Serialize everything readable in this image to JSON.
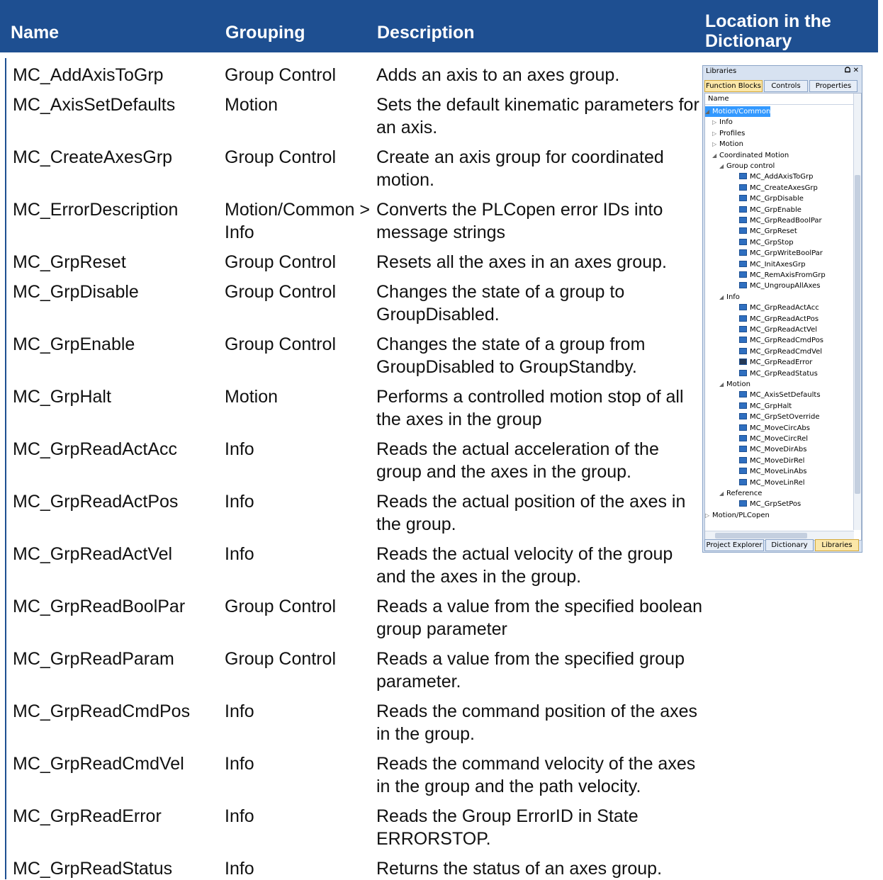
{
  "table": {
    "headers": {
      "name": "Name",
      "grouping": "Grouping",
      "description": "Description",
      "location": "Location in the Dictionary"
    },
    "rows": [
      {
        "name": "MC_AddAxisToGrp",
        "grouping": "Group Control",
        "description": "Adds an axis to an axes group."
      },
      {
        "name": "MC_AxisSetDefaults",
        "grouping": "Motion",
        "description": "Sets the default kinematic parameters for an axis."
      },
      {
        "name": "MC_CreateAxesGrp",
        "grouping": "Group Control",
        "description": "Create an axis group for coordinated motion."
      },
      {
        "name": "MC_ErrorDescription",
        "grouping": "Motion/Common > Info",
        "description": "Converts the PLCopen error IDs into message strings"
      },
      {
        "name": "MC_GrpReset",
        "grouping": "Group Control",
        "description": "Resets all the axes in an axes group."
      },
      {
        "name": "MC_GrpDisable",
        "grouping": "Group Control",
        "description": "Changes the state of a group to GroupDisabled."
      },
      {
        "name": "MC_GrpEnable",
        "grouping": "Group Control",
        "description": "Changes the state of a group from GroupDisabled to GroupStandby."
      },
      {
        "name": "MC_GrpHalt",
        "grouping": "Motion",
        "description": "Performs a controlled motion stop of all the axes in the group"
      },
      {
        "name": "MC_GrpReadActAcc",
        "grouping": "Info",
        "description": "Reads the actual acceleration of the group and the axes in the group."
      },
      {
        "name": "MC_GrpReadActPos",
        "grouping": "Info",
        "description": "Reads the actual position of the axes in the group."
      },
      {
        "name": "MC_GrpReadActVel",
        "grouping": "Info",
        "description": "Reads the actual velocity of the group and the axes in the group."
      },
      {
        "name": "MC_GrpReadBoolPar",
        "grouping": "Group Control",
        "description": "Reads a value from the specified boolean group parameter"
      },
      {
        "name": "MC_GrpReadParam",
        "grouping": "Group Control",
        "description": "Reads a value from the specified group parameter."
      },
      {
        "name": "MC_GrpReadCmdPos",
        "grouping": "Info",
        "description": "Reads the command position of the axes in the group."
      },
      {
        "name": "MC_GrpReadCmdVel",
        "grouping": "Info",
        "description": "Reads the command velocity of the axes in the group and the path velocity."
      },
      {
        "name": "MC_GrpReadError",
        "grouping": "Info",
        "description": "Reads the Group ErrorID in State ERRORSTOP."
      },
      {
        "name": "MC_GrpReadStatus",
        "grouping": "Info",
        "description": "Returns the status of an axes group."
      }
    ]
  },
  "libraries_panel": {
    "title": "Libraries",
    "window_buttons": "ᗝ ✕",
    "tabs": [
      "Function Blocks",
      "Controls",
      "Properties"
    ],
    "active_tab": "Function Blocks",
    "column_header": "Name",
    "tree": [
      {
        "label": "Motion/Common",
        "expander": "◢",
        "selected": true,
        "icon": "none"
      },
      {
        "label": "Info",
        "expander": "▷",
        "icon": "none"
      },
      {
        "label": "Profiles",
        "expander": "▷",
        "icon": "none"
      },
      {
        "label": "Motion",
        "expander": "▷",
        "icon": "none"
      },
      {
        "label": "Coordinated Motion",
        "expander": "◢",
        "icon": "none"
      },
      {
        "label": "Group control",
        "expander": "◢",
        "icon": "none"
      },
      {
        "label": "MC_AddAxisToGrp",
        "icon": "fb"
      },
      {
        "label": "MC_CreateAxesGrp",
        "icon": "fb"
      },
      {
        "label": "MC_GrpDisable",
        "icon": "fb"
      },
      {
        "label": "MC_GrpEnable",
        "icon": "fb"
      },
      {
        "label": "MC_GrpReadBoolPar",
        "icon": "fb"
      },
      {
        "label": "MC_GrpReset",
        "icon": "fb"
      },
      {
        "label": "MC_GrpStop",
        "icon": "fb"
      },
      {
        "label": "MC_GrpWriteBoolPar",
        "icon": "fb"
      },
      {
        "label": "MC_InitAxesGrp",
        "icon": "fb"
      },
      {
        "label": "MC_RemAxisFromGrp",
        "icon": "fb"
      },
      {
        "label": "MC_UngroupAllAxes",
        "icon": "fb"
      },
      {
        "label": "Info",
        "expander": "◢",
        "icon": "none"
      },
      {
        "label": "MC_GrpReadActAcc",
        "icon": "fb"
      },
      {
        "label": "MC_GrpReadActPos",
        "icon": "fb"
      },
      {
        "label": "MC_GrpReadActVel",
        "icon": "fb"
      },
      {
        "label": "MC_GrpReadCmdPos",
        "icon": "fb"
      },
      {
        "label": "MC_GrpReadCmdVel",
        "icon": "fb"
      },
      {
        "label": "MC_GrpReadError",
        "icon": "fb-dark"
      },
      {
        "label": "MC_GrpReadStatus",
        "icon": "fb"
      },
      {
        "label": "Motion",
        "expander": "◢",
        "icon": "none"
      },
      {
        "label": "MC_AxisSetDefaults",
        "icon": "fb"
      },
      {
        "label": "MC_GrpHalt",
        "icon": "fb"
      },
      {
        "label": "MC_GrpSetOverride",
        "icon": "fb"
      },
      {
        "label": "MC_MoveCircAbs",
        "icon": "fb"
      },
      {
        "label": "MC_MoveCircRel",
        "icon": "fb"
      },
      {
        "label": "MC_MoveDirAbs",
        "icon": "fb"
      },
      {
        "label": "MC_MoveDirRel",
        "icon": "fb"
      },
      {
        "label": "MC_MoveLinAbs",
        "icon": "fb"
      },
      {
        "label": "MC_MoveLinRel",
        "icon": "fb"
      },
      {
        "label": "Reference",
        "expander": "◢",
        "icon": "none"
      },
      {
        "label": "MC_GrpSetPos",
        "icon": "fb"
      },
      {
        "label": "Motion/PLCopen",
        "expander": "▷",
        "icon": "none"
      }
    ],
    "bottom_tabs": [
      "Project Explorer",
      "Dictionary",
      "Libraries"
    ],
    "active_bottom_tab": "Libraries"
  }
}
